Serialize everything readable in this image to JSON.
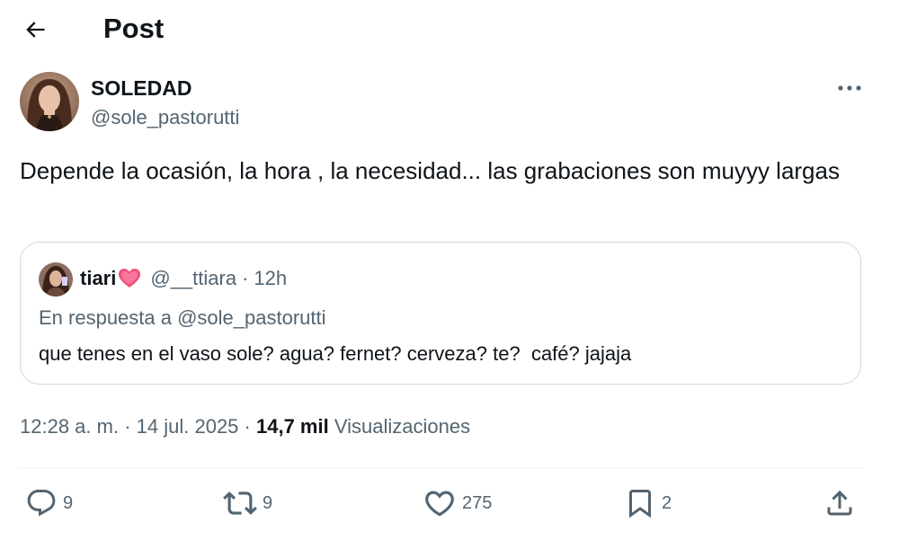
{
  "header": {
    "title": "Post",
    "back_icon": "arrow-left-icon"
  },
  "tweet": {
    "author_name": "SOLEDAD",
    "author_handle": "@sole_pastorutti",
    "text": "Depende la ocasión, la hora , la necesidad... las grabaciones son muyyy largas",
    "more_icon": "more-horizontal-icon",
    "time": "12:28 a. m.",
    "date": "14 jul. 2025",
    "views_count": "14,7 mil",
    "views_label": "Visualizaciones"
  },
  "quote": {
    "author_name": "tiari",
    "author_emoji": "heart-emoji",
    "author_handle": "@__ttiara",
    "separator": "·",
    "time": "12h",
    "reply_context": "En respuesta a @sole_pastorutti",
    "text": "que tenes en el vaso sole? agua? fernet? cerveza? te?  café? jajaja"
  },
  "actions": {
    "replies": "9",
    "reposts": "9",
    "likes": "275",
    "bookmarks": "2"
  },
  "colors": {
    "text_primary": "#0f1419",
    "text_secondary": "#536471",
    "border": "#cfd9de",
    "heart_emoji": "#f0507a"
  }
}
